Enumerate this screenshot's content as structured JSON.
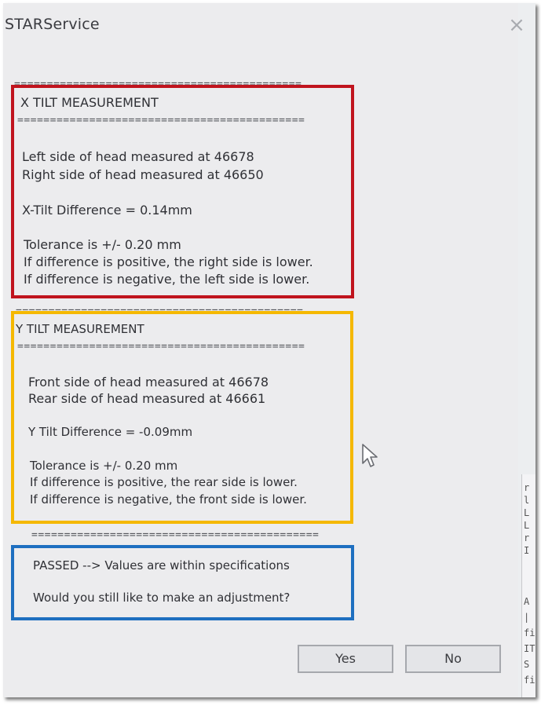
{
  "window": {
    "title": "STARService",
    "close_glyph": "×"
  },
  "separator": "============================================",
  "x_tilt": {
    "heading": "X TILT MEASUREMENT",
    "left": "Left side of head measured at 46678",
    "right": "Right side of head measured at 46650",
    "difference": "X-Tilt Difference = 0.14mm",
    "tolerance": "Tolerance is +/- 0.20 mm",
    "positive_note": "If difference is positive, the right side is lower.",
    "negative_note": "If difference is negative, the left side is lower."
  },
  "y_tilt": {
    "heading": "Y TILT MEASUREMENT",
    "front": "Front side of head measured at 46678",
    "rear": "Rear side of head measured at 46661",
    "difference": "Y Tilt Difference = -0.09mm",
    "tolerance": "Tolerance is +/- 0.20 mm",
    "positive_note": "If difference is positive, the rear side is lower.",
    "negative_note": "If difference is negative, the front side is lower."
  },
  "result": {
    "status": "PASSED --> Values are within specifications",
    "question": "Would you still like to make an adjustment?"
  },
  "buttons": {
    "yes": "Yes",
    "no": "No"
  },
  "background_window_chars": [
    "r",
    "l",
    "L",
    "L",
    "r",
    "I",
    "A",
    "|",
    "fi",
    "IT",
    "S",
    "fir"
  ],
  "highlight_colors": {
    "x_tilt": "#c0141e",
    "y_tilt": "#f5b800",
    "result": "#1e6fc0"
  }
}
